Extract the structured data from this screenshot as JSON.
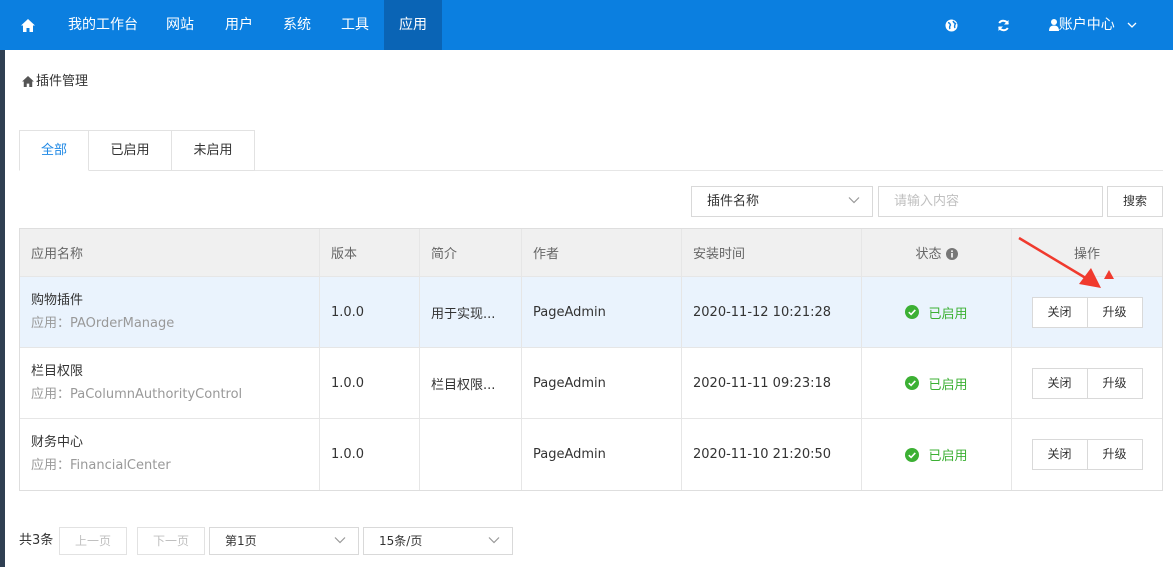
{
  "nav": {
    "items": [
      {
        "label": "我的工作台"
      },
      {
        "label": "网站"
      },
      {
        "label": "用户"
      },
      {
        "label": "系统"
      },
      {
        "label": "工具"
      },
      {
        "label": "应用",
        "active": true
      }
    ],
    "account_label": "账户中心"
  },
  "breadcrumb": {
    "label": "插件管理"
  },
  "tabs": [
    {
      "label": "全部",
      "active": true
    },
    {
      "label": "已启用"
    },
    {
      "label": "未启用"
    }
  ],
  "search": {
    "field_value": "插件名称",
    "placeholder": "请输入内容",
    "button_label": "搜索"
  },
  "table": {
    "columns": [
      "应用名称",
      "版本",
      "简介",
      "作者",
      "安装时间",
      "状态",
      "操作"
    ],
    "rows": [
      {
        "name": "购物插件",
        "code": "应用：PAOrderManage",
        "version": "1.0.0",
        "desc": "用于实现...",
        "author": "PageAdmin",
        "installed": "2020-11-12 10:21:28",
        "status": "已启用",
        "close": "关闭",
        "upgrade": "升级"
      },
      {
        "name": "栏目权限",
        "code": "应用：PaColumnAuthorityControl",
        "version": "1.0.0",
        "desc": "栏目权限...",
        "author": "PageAdmin",
        "installed": "2020-11-11 09:23:18",
        "status": "已启用",
        "close": "关闭",
        "upgrade": "升级"
      },
      {
        "name": "财务中心",
        "code": "应用：FinancialCenter",
        "version": "1.0.0",
        "desc": "",
        "author": "PageAdmin",
        "installed": "2020-11-10 21:20:50",
        "status": "已启用",
        "close": "关闭",
        "upgrade": "升级"
      }
    ]
  },
  "pagination": {
    "total": "共3条",
    "prev": "上一页",
    "next": "下一页",
    "page": "第1页",
    "page_size": "15条/页"
  },
  "colors": {
    "nav_bg": "#0b7fe0",
    "nav_active": "#0a64b5",
    "status_green": "#3cb034",
    "tab_active": "#1e88e5",
    "highlight_row": "#eaf3fd",
    "arrow_red": "#f03a2e"
  },
  "icons": [
    "home-icon",
    "globe-icon",
    "refresh-icon",
    "user-icon",
    "chevron-down-icon",
    "info-icon",
    "check-circle-icon"
  ]
}
